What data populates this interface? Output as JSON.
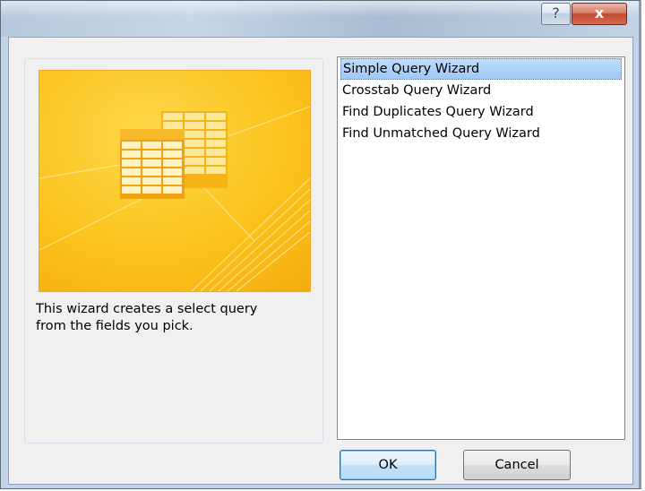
{
  "window": {
    "help_label": "?",
    "close_label": "x"
  },
  "preview": {
    "description": "This wizard creates a select query\nfrom the fields you pick."
  },
  "wizard_list": {
    "items": [
      {
        "label": "Simple Query Wizard",
        "selected": true
      },
      {
        "label": "Crosstab Query Wizard",
        "selected": false
      },
      {
        "label": "Find Duplicates Query Wizard",
        "selected": false
      },
      {
        "label": "Find Unmatched Query Wizard",
        "selected": false
      }
    ]
  },
  "buttons": {
    "ok_label": "OK",
    "cancel_label": "Cancel"
  },
  "colors": {
    "selection": "#9fc9f6",
    "preview_background": "#fcc31c",
    "preview_border": "#f5a623"
  }
}
